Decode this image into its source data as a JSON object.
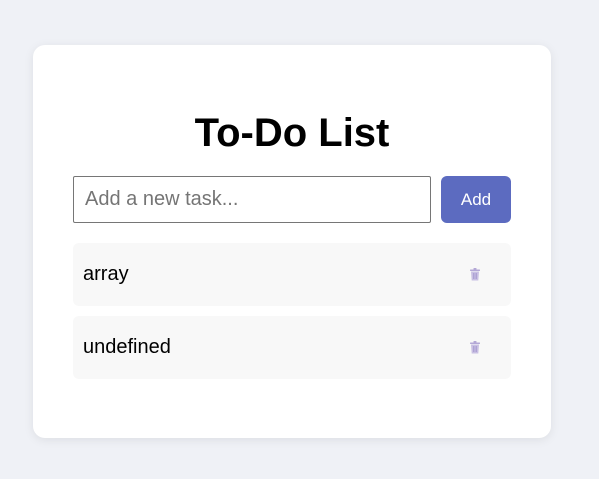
{
  "app": {
    "title": "To-Do List"
  },
  "new_task": {
    "placeholder": "Add a new task...",
    "value": "",
    "add_label": "Add"
  },
  "tasks": [
    {
      "text": "array",
      "delete_icon": "trash-icon"
    },
    {
      "text": "undefined",
      "delete_icon": "trash-icon"
    }
  ],
  "colors": {
    "background": "#eff1f6",
    "card": "#ffffff",
    "accent": "#5c6bc0",
    "task_background": "#f8f8f8",
    "delete_icon": "#b4a8d6"
  }
}
